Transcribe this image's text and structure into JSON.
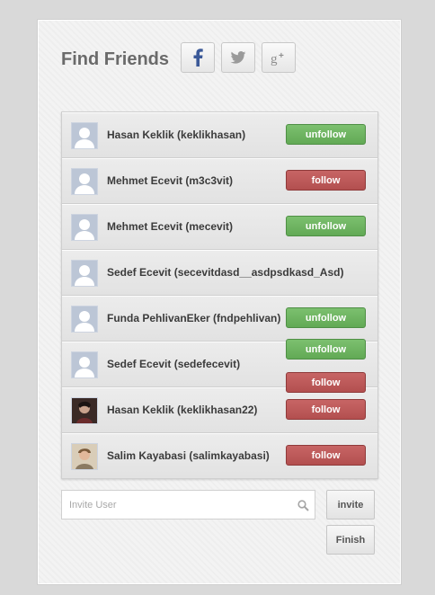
{
  "header": {
    "title": "Find Friends",
    "social": [
      {
        "name": "facebook",
        "glyph": "f"
      },
      {
        "name": "twitter",
        "glyph": "twitter-bird"
      },
      {
        "name": "google-plus",
        "glyph": "g+"
      }
    ]
  },
  "friends": [
    {
      "name": "Hasan Keklik (keklikhasan)",
      "avatar": "default",
      "actions": [
        "unfollow"
      ]
    },
    {
      "name": "Mehmet Ecevit (m3c3vit)",
      "avatar": "default",
      "actions": [
        "follow"
      ]
    },
    {
      "name": "Mehmet Ecevit (mecevit)",
      "avatar": "default",
      "actions": [
        "unfollow"
      ]
    },
    {
      "name": "Sedef Ecevit (secevitdasd__asdpsdkasd_Asd)",
      "avatar": "default",
      "actions": []
    },
    {
      "name": "Funda PehlivanEker (fndpehlivan)",
      "avatar": "default",
      "actions": [
        "unfollow"
      ]
    },
    {
      "name": "Sedef Ecevit (sedefecevit)",
      "avatar": "default",
      "actions": [
        "unfollow",
        "follow"
      ]
    },
    {
      "name": "Hasan Keklik (keklikhasan22)",
      "avatar": "photo-dark",
      "actions": [
        "follow"
      ]
    },
    {
      "name": "Salim Kayabasi (salimkayabasi)",
      "avatar": "photo-light",
      "actions": [
        "follow"
      ]
    }
  ],
  "labels": {
    "follow": "follow",
    "unfollow": "unfollow"
  },
  "invite": {
    "placeholder": "Invite User",
    "value": "",
    "invite_label": "invite",
    "finish_label": "Finish"
  },
  "colors": {
    "unfollow": "#6cb35f",
    "follow": "#bd5959",
    "title": "#6a6a6a",
    "facebook": "#3b5998"
  }
}
